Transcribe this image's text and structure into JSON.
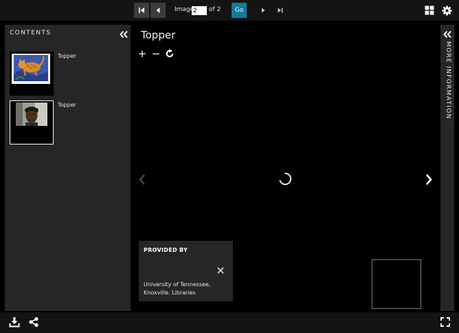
{
  "pager": {
    "label_before": "Image",
    "current_page": "2",
    "label_after": "of 2",
    "go_label": "Go"
  },
  "contents": {
    "title": "CONTENTS",
    "items": [
      {
        "label": "Topper",
        "selected": false
      },
      {
        "label": "Topper",
        "selected": true
      }
    ]
  },
  "viewer": {
    "title": "Topper",
    "zoom_in": "+",
    "zoom_out": "−"
  },
  "provided_by": {
    "title": "PROVIDED BY",
    "text": "University of Tennessee, Knoxville. Libraries"
  },
  "more_information": {
    "label": "MORE INFORMATION"
  },
  "colors": {
    "accent": "#117b9a",
    "panel": "#262626",
    "bar": "#141414"
  }
}
